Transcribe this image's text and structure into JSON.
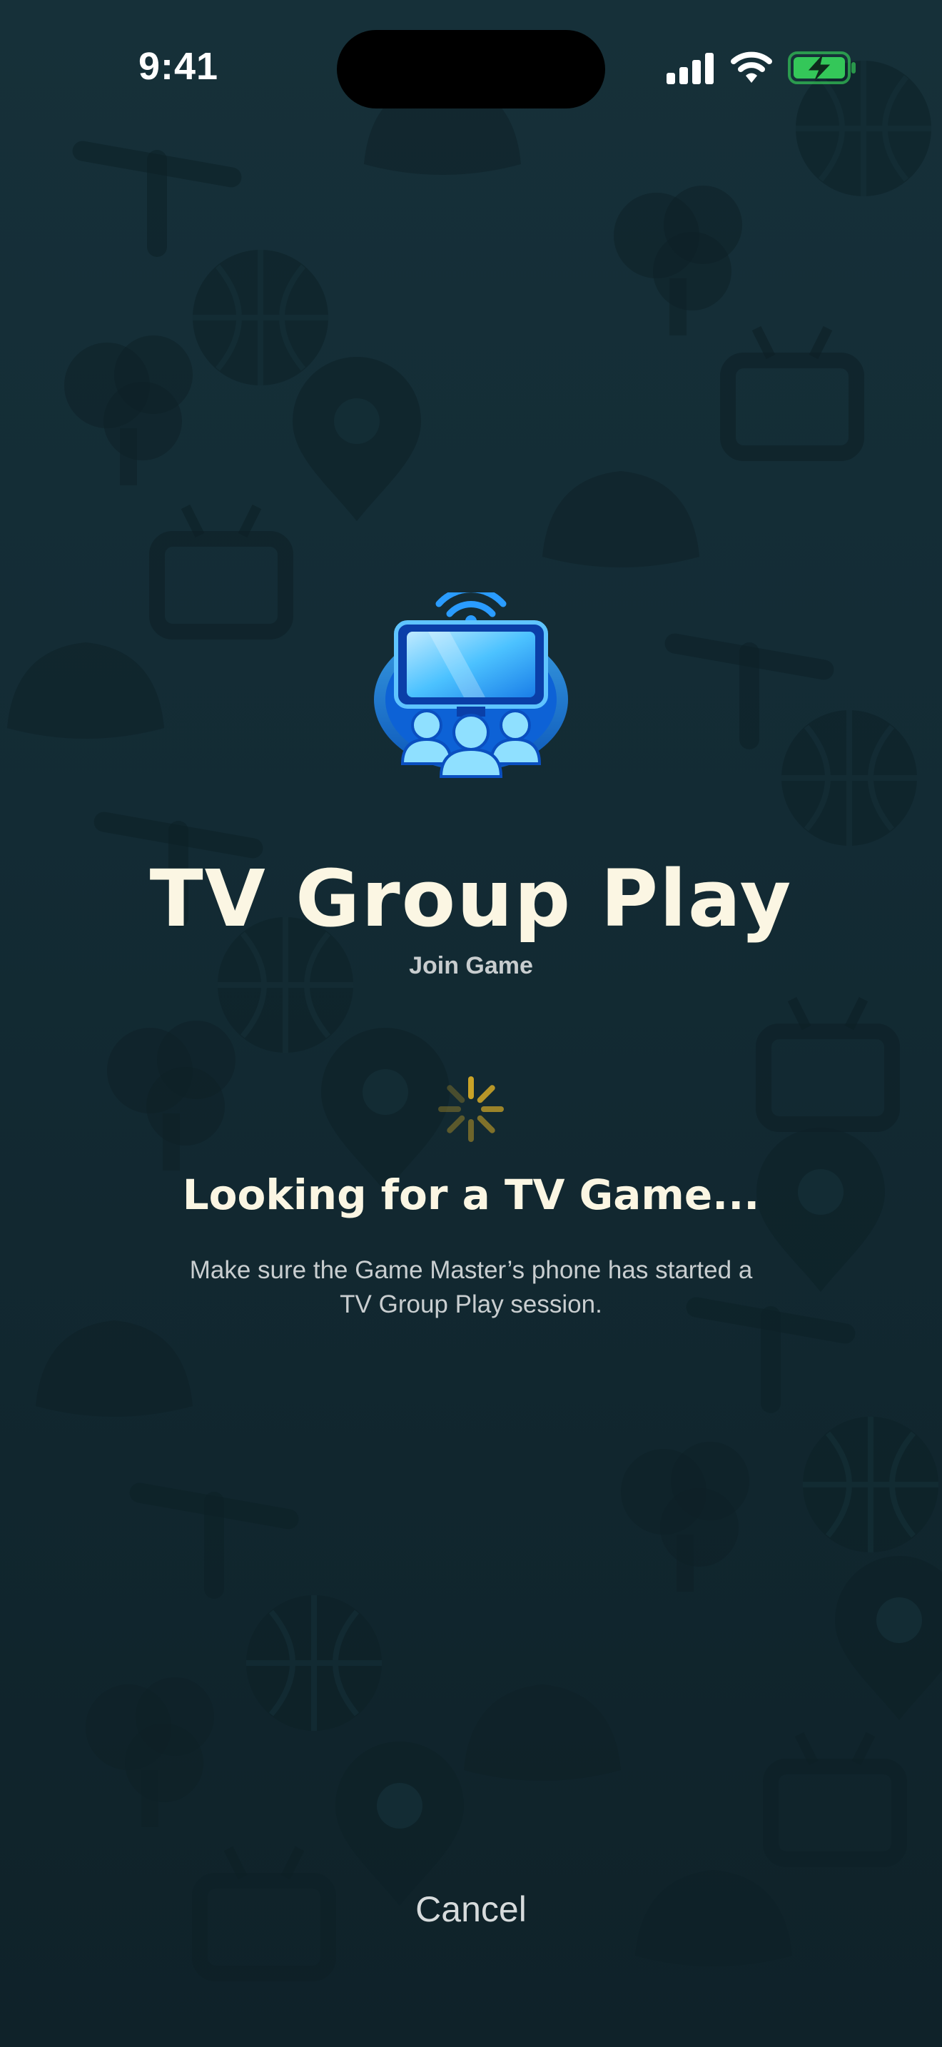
{
  "status_bar": {
    "time": "9:41",
    "icons": [
      "cellular-signal-icon",
      "wifi-icon",
      "battery-charging-icon"
    ],
    "battery_color": "#34c759"
  },
  "header": {
    "logo_icon": "tv-group-icon",
    "title": "TV Group Play",
    "subtitle": "Join Game"
  },
  "status": {
    "spinner_icon": "loading-spinner-icon",
    "spinner_color": "#c9a227",
    "heading": "Looking for a TV Game...",
    "description": "Make sure the Game Master’s phone has started a TV Group Play session."
  },
  "actions": {
    "cancel_label": "Cancel"
  },
  "colors": {
    "background": "#132b34",
    "title": "#fbf6e3",
    "accent_blue": "#1f8df0"
  }
}
